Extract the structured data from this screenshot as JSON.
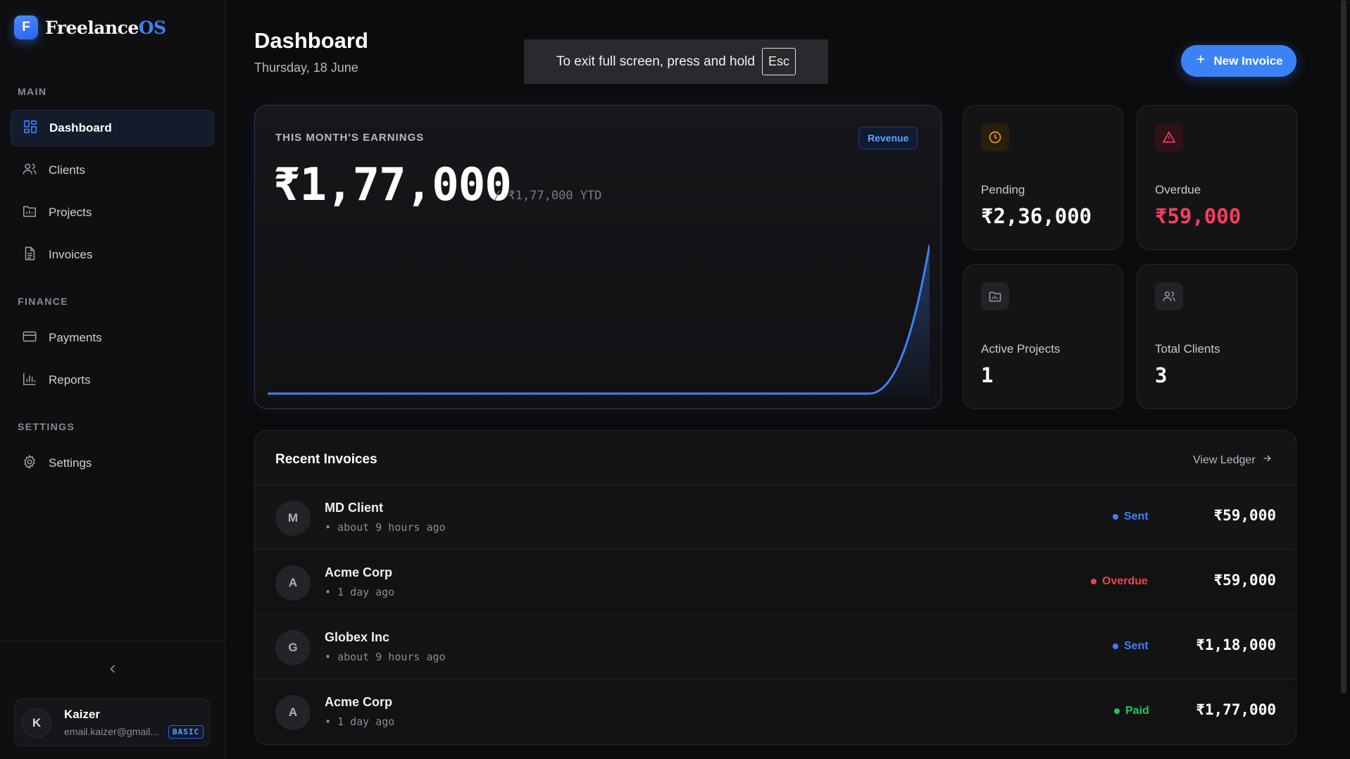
{
  "brand": {
    "logo_letter": "F",
    "name_main": "Freelance",
    "name_accent": "OS",
    "accent_color": "#3b82f6"
  },
  "sidebar": {
    "sections": [
      "MAIN",
      "FINANCE",
      "SETTINGS"
    ],
    "items": [
      {
        "label": "Dashboard",
        "icon": "dashboard-grid-icon",
        "active": true
      },
      {
        "label": "Clients",
        "icon": "users-icon"
      },
      {
        "label": "Projects",
        "icon": "folder-icon"
      },
      {
        "label": "Invoices",
        "icon": "file-text-icon"
      },
      {
        "label": "Payments",
        "icon": "credit-card-icon"
      },
      {
        "label": "Reports",
        "icon": "bar-chart-icon"
      },
      {
        "label": "Settings",
        "icon": "gear-icon"
      }
    ],
    "collapse_icon": "chevron-left-icon",
    "user": {
      "initial": "K",
      "name": "Kaizer",
      "email": "email.kaizer@gmail...",
      "plan": "BASIC"
    }
  },
  "header": {
    "title": "Dashboard",
    "date": "Thursday, 18 June",
    "fullscreen_notice": "To exit full screen, press and hold",
    "fullscreen_key": "Esc",
    "new_invoice_label": "New Invoice"
  },
  "earnings": {
    "label": "THIS MONTH'S EARNINGS",
    "badge": "Revenue",
    "value": "₹1,77,000",
    "ytd": "/ ₹1,77,000 YTD"
  },
  "chart_data": {
    "type": "area",
    "title": "",
    "xlabel": "",
    "ylabel": "",
    "x": [
      0,
      1,
      2,
      3,
      4,
      5,
      6,
      7,
      8,
      9,
      10,
      11
    ],
    "series": [
      {
        "values": [
          0,
          0,
          0,
          0,
          0,
          0,
          0,
          0,
          0,
          0,
          0,
          177000
        ]
      }
    ],
    "ylim": [
      0,
      177000
    ],
    "grid": false,
    "line_color": "#3b82f6"
  },
  "stats": [
    {
      "label": "Pending",
      "value": "₹2,36,000",
      "icon": "clock-icon",
      "color": "#f59e0b"
    },
    {
      "label": "Overdue",
      "value": "₹59,000",
      "icon": "alert-triangle-icon",
      "color": "#f43f5e"
    },
    {
      "label": "Active Projects",
      "value": "1",
      "icon": "folder-icon",
      "color": "#9a9aa4"
    },
    {
      "label": "Total Clients",
      "value": "3",
      "icon": "users-icon",
      "color": "#9a9aa4"
    }
  ],
  "invoices": {
    "title": "Recent Invoices",
    "ledger_label": "View Ledger",
    "rows": [
      {
        "initial": "M",
        "client": "MD Client",
        "time": "• about 9 hours ago",
        "status": "Sent",
        "status_color": "#3b82f6",
        "amount": "₹59,000"
      },
      {
        "initial": "A",
        "client": "Acme Corp",
        "time": "• 1 day ago",
        "status": "Overdue",
        "status_color": "#ef4444",
        "amount": "₹59,000"
      },
      {
        "initial": "G",
        "client": "Globex Inc",
        "time": "• about 9 hours ago",
        "status": "Sent",
        "status_color": "#3b82f6",
        "amount": "₹1,18,000"
      },
      {
        "initial": "A",
        "client": "Acme Corp",
        "time": "• 1 day ago",
        "status": "Paid",
        "status_color": "#22c55e",
        "amount": "₹1,77,000"
      }
    ]
  }
}
